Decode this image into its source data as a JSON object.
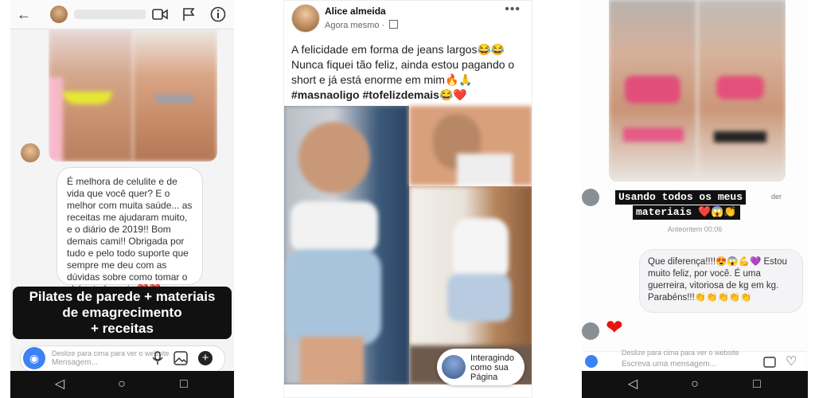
{
  "panel1": {
    "message": "É melhora de celulite e de vida que você quer? E o melhor com muita saúde... as receitas me ajudaram muito, e o diário de 2019!! Bom demais cami!! Obrigada por tudo e pelo todo suporte que sempre me deu com as dúvidas sobre como tomar o chá e tudo mais ❤️❤️",
    "caption_lines": [
      "Pilates de parede + materiais",
      "de emagrecimento",
      "+ receitas"
    ],
    "swipe_hint": "Deslize para cima para ver o website",
    "input_placeholder": "Mensagem...",
    "icons": [
      "back-arrow-icon",
      "video-call-icon",
      "flag-icon",
      "info-icon",
      "camera-icon",
      "mic-icon",
      "gallery-icon",
      "plus-icon"
    ]
  },
  "panel2": {
    "author": "Alice almeida",
    "meta": "Agora mesmo ·",
    "more": "•••",
    "post_text": "A felicidade em forma de jeans largos😂😂 Nunca fiquei tão feliz, ainda estou pagando o short e já está enorme em mim🔥🙏",
    "hashtags": "#masnaoligo #tofelizdemais😂❤️",
    "page_pill": "Interagindo como sua Página"
  },
  "panel3": {
    "label_line1": "Usando todos os meus",
    "label_line2": "materiais ❤️😱👏",
    "label_suffix": "der",
    "timestamp": "Anteontem 00:06",
    "reply": "Que diferença!!!!😍😱💪💜 Estou muito feliz, por você. É uma guerreira, vitoriosa de kg em kg. Parabéns!!!👏👏👏👏👏",
    "heart": "❤",
    "swipe_hint": "Deslize para cima para ver o website",
    "input_placeholder": "Escreva uma mensagem..."
  },
  "nav": {
    "back": "◁",
    "home": "○",
    "recent": "□"
  },
  "colors": {
    "heart": "#ee1111",
    "camera_button": "#3b82f6",
    "caption_bg": "#111111"
  }
}
